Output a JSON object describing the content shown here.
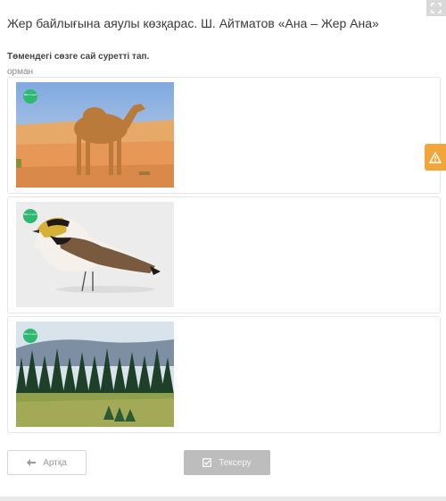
{
  "header": {
    "title": "Жер байлығына аяулы көзқарас. Ш. Айтматов «Ана – Жер Ана»"
  },
  "task": {
    "question": "Төмендегі сөзге сай суретті тап.",
    "word": "орман"
  },
  "options": [
    {
      "subject": "camel",
      "badge": "Bilim Land"
    },
    {
      "subject": "bird",
      "badge": "Bilim Land"
    },
    {
      "subject": "forest",
      "badge": "Bilim Land"
    }
  ],
  "buttons": {
    "back_label": "Артқа",
    "check_label": "Тексеру"
  },
  "icons": {
    "fullscreen": "fullscreen-icon",
    "warning": "warning-icon",
    "back": "arrow-left-icon",
    "check": "checkbox-icon"
  },
  "colors": {
    "accent_green": "#2eb872",
    "warning": "#f2a53a",
    "disabled_button": "#bdbdbd"
  }
}
